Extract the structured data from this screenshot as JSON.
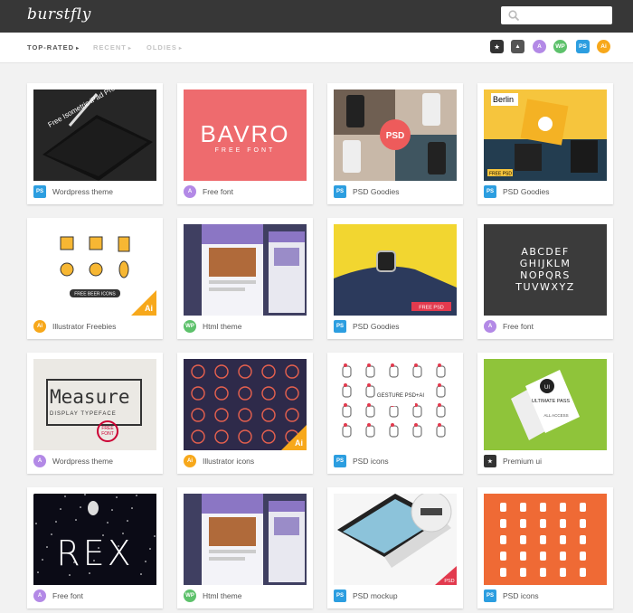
{
  "app": {
    "logo": "burstfly"
  },
  "search": {
    "placeholder": ""
  },
  "filters": [
    {
      "label": "TOP-RATED",
      "active": true
    },
    {
      "label": "RECENT",
      "active": false
    },
    {
      "label": "OLDIES",
      "active": false
    }
  ],
  "type_buttons": [
    {
      "name": "premium-filter-icon",
      "glyph": "★",
      "shape": "sq",
      "color": "#333333"
    },
    {
      "name": "photo-filter-icon",
      "glyph": "▲",
      "shape": "sq",
      "color": "#555555"
    },
    {
      "name": "font-filter-icon",
      "glyph": "A",
      "shape": "rd",
      "color": "#b389e6"
    },
    {
      "name": "wordpress-filter-icon",
      "glyph": "WP",
      "shape": "rd",
      "color": "#5dc16b"
    },
    {
      "name": "photoshop-filter-icon",
      "glyph": "PS",
      "shape": "sq",
      "color": "#2c9ee0"
    },
    {
      "name": "illustrator-filter-icon",
      "glyph": "Ai",
      "shape": "rd",
      "color": "#f7a81b"
    }
  ],
  "colors": {
    "ps": "#2c9ee0",
    "font": "#b389e6",
    "wp": "#5dc16b",
    "ai": "#f7a81b",
    "premium": "#333333"
  },
  "cards": [
    {
      "label": "Wordpress theme",
      "badge": "PS",
      "type": "ps",
      "thumb": {
        "kind": "ipad",
        "text": "Free Isometric iPad Pro mockup"
      }
    },
    {
      "label": "Free font",
      "badge": "A",
      "type": "font",
      "thumb": {
        "kind": "bavro",
        "title": "BAVRO",
        "sub": "FREE FONT"
      }
    },
    {
      "label": "PSD Goodies",
      "badge": "PS",
      "type": "ps",
      "thumb": {
        "kind": "phones",
        "tag": "PSD"
      }
    },
    {
      "label": "PSD Goodies",
      "badge": "PS",
      "type": "ps",
      "thumb": {
        "kind": "berlin",
        "title": "Berlin",
        "tag": "FREE PSD"
      }
    },
    {
      "label": "Illustrator Freebies",
      "badge": "Ai",
      "type": "ai",
      "thumb": {
        "kind": "beer",
        "text": "FREE BEER ICONS",
        "corner": "Ai"
      }
    },
    {
      "label": "Html theme",
      "badge": "WP",
      "type": "wp",
      "thumb": {
        "kind": "website"
      }
    },
    {
      "label": "PSD Goodies",
      "badge": "PS",
      "type": "ps",
      "thumb": {
        "kind": "watch",
        "tag": "FREE PSD"
      }
    },
    {
      "label": "Free font",
      "badge": "A",
      "type": "font",
      "thumb": {
        "kind": "alphabet",
        "rows": [
          "ABCDEF",
          "GHIJKLM",
          "NOPQRS",
          "TUVWXYZ"
        ]
      }
    },
    {
      "label": "Wordpress theme",
      "badge": "A",
      "type": "font",
      "thumb": {
        "kind": "measure",
        "title": "Measure",
        "sub": "DISPLAY TYPEFACE",
        "stamp": "FREE FONT"
      }
    },
    {
      "label": "Illustrator icons",
      "badge": "Ai",
      "type": "ai",
      "thumb": {
        "kind": "space",
        "corner": "Ai"
      }
    },
    {
      "label": "PSD icons",
      "badge": "PS",
      "type": "ps",
      "thumb": {
        "kind": "gesture",
        "text": "GESTURE PSD+AI"
      }
    },
    {
      "label": "Premium ui",
      "badge": "★",
      "type": "premium",
      "thumb": {
        "kind": "ticket",
        "text": "ULTIMATE PASS",
        "sub": "ALL ACCESS"
      }
    },
    {
      "label": "Free font",
      "badge": "A",
      "type": "font",
      "thumb": {
        "kind": "rex",
        "title": "REX"
      }
    },
    {
      "label": "Html theme",
      "badge": "WP",
      "type": "wp",
      "thumb": {
        "kind": "website"
      }
    },
    {
      "label": "PSD mockup",
      "badge": "PS",
      "type": "ps",
      "thumb": {
        "kind": "laptop",
        "tag": "PSD"
      }
    },
    {
      "label": "PSD icons",
      "badge": "PS",
      "type": "ps",
      "thumb": {
        "kind": "hands"
      }
    }
  ]
}
